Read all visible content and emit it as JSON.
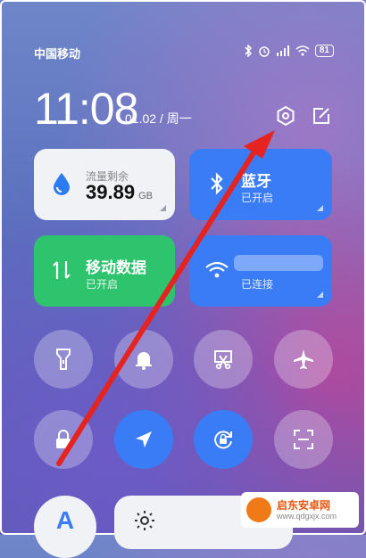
{
  "status_bar": {
    "carrier": "中国移动",
    "battery": "81"
  },
  "clock": {
    "time": "11:08",
    "date": "01.02 / 周一"
  },
  "tiles": {
    "data_usage": {
      "label": "流量剩余",
      "value": "39.89",
      "unit": "GB"
    },
    "bluetooth": {
      "title": "蓝牙",
      "status": "已开启"
    },
    "mobile_data": {
      "title": "移动数据",
      "status": "已开启"
    },
    "wifi": {
      "status": "已连接"
    }
  },
  "bottom": {
    "font_button": "A"
  },
  "watermark": {
    "title": "启东安卓网",
    "url": "www.qdgxjx.com"
  },
  "colors": {
    "accent": "#3a7cf5",
    "green": "#2ec46d",
    "annotation": "#e52421"
  }
}
